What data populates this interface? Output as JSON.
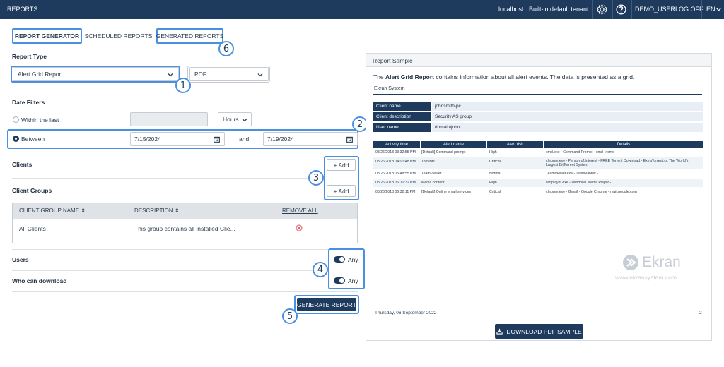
{
  "topbar": {
    "title": "REPORTS",
    "server": "localhost",
    "tenant": "Built-in default tenant",
    "user": "DEMO_USER",
    "logoff": "LOG OFF",
    "lang": "EN",
    "settings_icon": "gear-icon",
    "help_icon": "question-icon",
    "lang_icon": "chevron-down-icon"
  },
  "tabs": [
    {
      "label": "REPORT GENERATOR"
    },
    {
      "label": "SCHEDULED REPORTS"
    },
    {
      "label": "GENERATED REPORTS"
    }
  ],
  "report_type": {
    "label": "Report Type",
    "report": "Alert Grid Report",
    "format": "PDF"
  },
  "date_filters": {
    "label": "Date Filters",
    "within_label": "Within the last",
    "within_value": "",
    "unit": "Hours",
    "between_label": "Between",
    "from": "7/15/2024",
    "and": "and",
    "to": "7/19/2024"
  },
  "clients": {
    "label": "Clients",
    "add": "+ Add"
  },
  "client_groups": {
    "label": "Client Groups",
    "add": "+ Add",
    "columns": [
      "CLIENT GROUP NAME",
      "DESCRIPTION",
      "REMOVE ALL"
    ],
    "rows": [
      {
        "name": "All Clients",
        "description": "This group contains all installed Clie..."
      }
    ]
  },
  "users": {
    "label": "Users",
    "value": "Any"
  },
  "who_can_download": {
    "label": "Who can download",
    "value": "Any"
  },
  "generate_button": "GENERATE REPORT",
  "callouts": [
    "1",
    "2",
    "3",
    "4",
    "5",
    "6"
  ],
  "sample": {
    "title": "Report Sample",
    "desc_prefix": "The",
    "desc_bold": "Alert Grid Report",
    "desc_rest": "contains information about all alert events. The data is presented as a grid.",
    "org": "Ekran System",
    "info": [
      {
        "k": "Client name",
        "v": "johnsmith-pc"
      },
      {
        "k": "Client description",
        "v": "Security AS group"
      },
      {
        "k": "User name",
        "v": "domain\\john"
      }
    ],
    "alert_columns": [
      "Activity time",
      "Alert name",
      "Alert risk",
      "Details"
    ],
    "alerts": [
      {
        "time": "08/26/2018 03:32:55 PM",
        "name": "[Default] Command prompt",
        "risk": "High",
        "details": "cmd.exe - Command Prompt - cmd-->cmd"
      },
      {
        "time": "08/26/2018 04:00:48 PM",
        "name": "Torrents",
        "risk": "Critical",
        "details": "chrome.exe - Person.of.Interest - FREE Torrent Download - ExtraTorrent.cc The World's Largest BitTorrent System"
      },
      {
        "time": "08/26/2018 05:48:55 PM",
        "name": "TeamViewer",
        "risk": "Normal",
        "details": "TeamViewer.exe - TeamViewer -"
      },
      {
        "time": "08/26/2018 06:10:32 PM",
        "name": "Media content",
        "risk": "High",
        "details": "wmplayer.exe - Windows Media Player -"
      },
      {
        "time": "08/26/2018 06:32:11 PM",
        "name": "[Default] Online email services",
        "risk": "Critical",
        "details": "chrome.exe - Gmail - Google Chrome - mail.google.com"
      }
    ],
    "watermark": "Ekran",
    "watermark_url": "www.ekransystem.com",
    "footer_date": "Thursday, 06 September 2022",
    "footer_page": "2",
    "download_button": "DOWNLOAD PDF SAMPLE"
  }
}
